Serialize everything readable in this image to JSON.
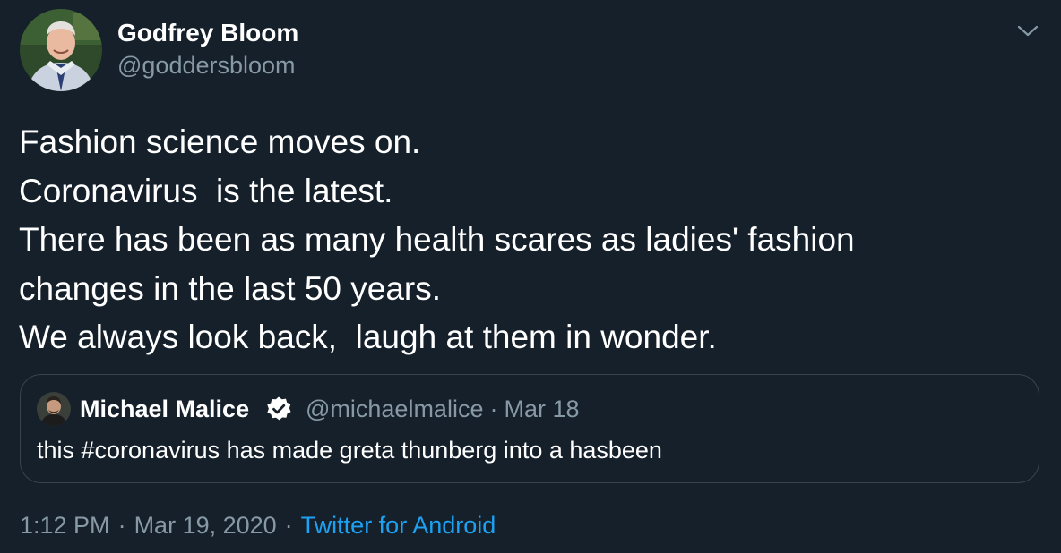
{
  "author": {
    "display_name": "Godfrey Bloom",
    "handle": "@goddersbloom"
  },
  "tweet": {
    "lines": [
      "Fashion science moves on.",
      "Coronavirus  is the latest.",
      "There has been as many health scares as ladies' fashion",
      "changes in the last 50 years.",
      "We always look back,  laugh at them in wonder."
    ]
  },
  "quoted_tweet": {
    "display_name": "Michael Malice",
    "verified": true,
    "handle": "@michaelmalice",
    "separator": "·",
    "date": "Mar 18",
    "text": "this #coronavirus has made greta thunberg into a hasbeen"
  },
  "footer": {
    "time": "1:12 PM",
    "separator": "·",
    "date": "Mar 19, 2020",
    "source": "Twitter for Android"
  },
  "icons": {
    "caret": "chevron-down-icon",
    "verified": "verified-badge-icon"
  },
  "colors": {
    "background": "#15202b",
    "primary_text": "#ffffff",
    "secondary_text": "#8899a6",
    "link": "#1da1f2",
    "border": "#38444d"
  }
}
